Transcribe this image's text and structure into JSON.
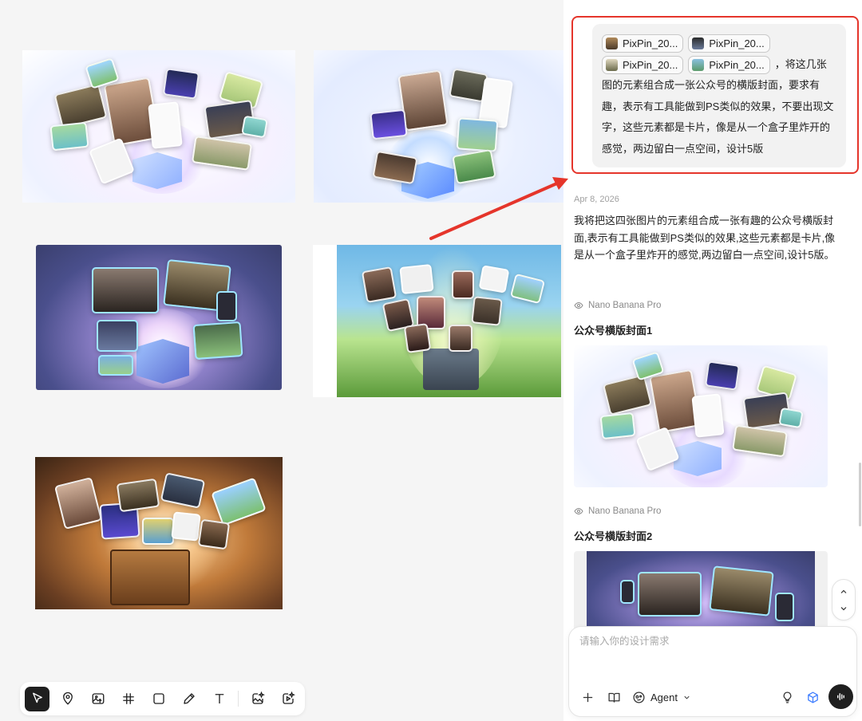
{
  "user_message": {
    "attachments": [
      {
        "label": "PixPin_20...",
        "color": "#7a5a3a"
      },
      {
        "label": "PixPin_20...",
        "color": "#5a6a8a"
      },
      {
        "label": "PixPin_20...",
        "color": "#8a8a6a"
      },
      {
        "label": "PixPin_20...",
        "color": "#6a9a7a"
      }
    ],
    "text_line1": "，将这几",
    "text_rest": "张图的元素组合成一张公众号的横版封面，要求有趣，表示有工具能做到PS类似的效果，不要出现文字，这些元素都是卡片，像是从一个盒子里炸开的感觉，两边留白一点空间，设计5版"
  },
  "reply": {
    "date": "Apr 8, 2026",
    "text": "我将把这四张图片的元素组合成一张有趣的公众号横版封面,表示有工具能做到PS类似的效果,这些元素都是卡片,像是从一个盒子里炸开的感觉,两边留白一点空间,设计5版。"
  },
  "results": [
    {
      "model": "Nano Banana Pro",
      "title": "公众号横版封面1"
    },
    {
      "model": "Nano Banana Pro",
      "title": "公众号横版封面2"
    }
  ],
  "composer": {
    "placeholder": "请输入你的设计需求",
    "agent_label": "Agent"
  },
  "toolbar": {
    "tools": [
      "select-tool",
      "marker-tool",
      "image-upload-tool",
      "frame-tool",
      "rectangle-tool",
      "pen-tool",
      "text-tool",
      "image-generate-tool",
      "video-generate-tool"
    ]
  },
  "colors": {
    "accent_red": "#e5352b",
    "active_tool": "#1f1f1f"
  }
}
